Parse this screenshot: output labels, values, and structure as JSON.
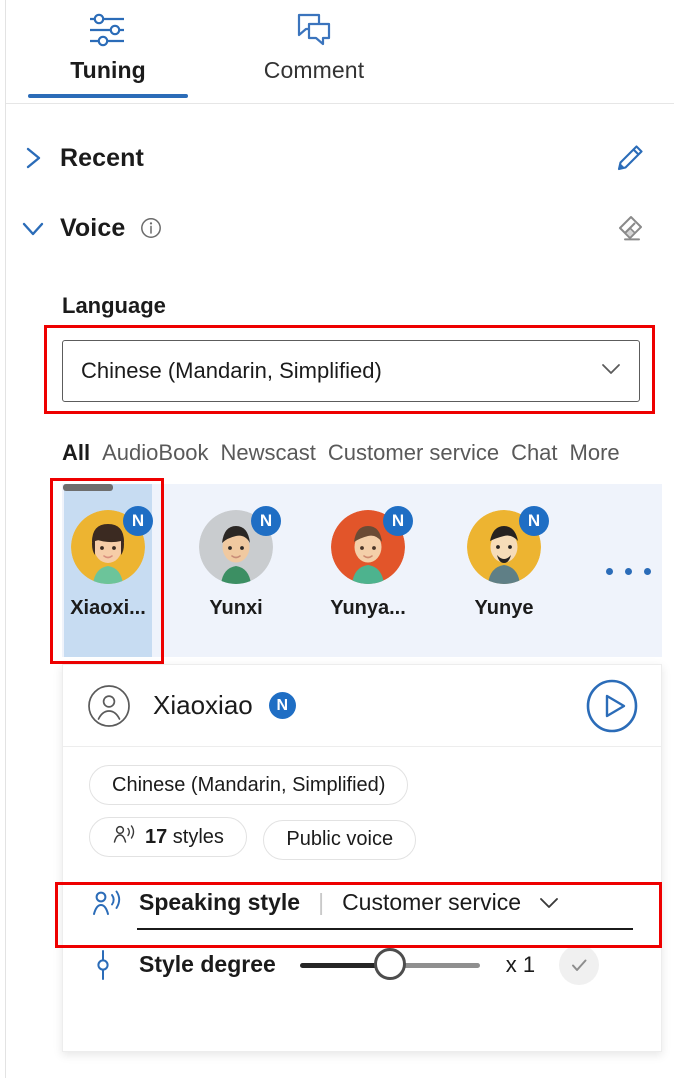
{
  "tabs": [
    {
      "label": "Tuning",
      "icon": "tuning-sliders-icon",
      "active": true
    },
    {
      "label": "Comment",
      "icon": "comment-bubbles-icon",
      "active": false
    }
  ],
  "sections": {
    "recent": {
      "title": "Recent",
      "expanded": false,
      "action_icon": "pencil-edit-icon"
    },
    "voice": {
      "title": "Voice",
      "expanded": true,
      "info_icon": "info-circle-icon",
      "action_icon": "eraser-icon"
    }
  },
  "language": {
    "label": "Language",
    "value": "Chinese (Mandarin, Simplified)",
    "chevron_icon": "chevron-down-icon",
    "highlight_color": "#ee0000"
  },
  "categories": [
    {
      "label": "All",
      "active": true
    },
    {
      "label": "AudioBook",
      "active": false
    },
    {
      "label": "Newscast",
      "active": false
    },
    {
      "label": "Customer service",
      "active": false
    },
    {
      "label": "Chat",
      "active": false
    },
    {
      "label": "More",
      "active": false
    }
  ],
  "voices": [
    {
      "name": "Xiaoxi...",
      "badge": "N",
      "selected": true,
      "avatar_bg": "#edb431",
      "hair": "#3b2a21",
      "skin": "#f6cda8",
      "shirt": "#6cc49a"
    },
    {
      "name": "Yunxi",
      "badge": "N",
      "selected": false,
      "avatar_bg": "#c9cccf",
      "hair": "#2b2724",
      "skin": "#f0c9a0",
      "shirt": "#3c8f63"
    },
    {
      "name": "Yunya...",
      "badge": "N",
      "selected": false,
      "avatar_bg": "#e2552a",
      "hair": "#6b4b35",
      "skin": "#f4cfa9",
      "shirt": "#4db38e"
    },
    {
      "name": "Yunye",
      "badge": "N",
      "selected": false,
      "avatar_bg": "#edb431",
      "hair": "#262220",
      "skin": "#f6dcb8",
      "shirt": "#5f7f86"
    }
  ],
  "voice_more_icon": "more-horizontal-icon",
  "detail": {
    "person_icon": "person-circle-icon",
    "name": "Xiaoxiao",
    "badge": "N",
    "play_icon": "play-circle-icon",
    "tags": [
      {
        "label": "Chinese (Mandarin, Simplified)",
        "icon": null
      },
      {
        "label": "17 styles",
        "bold_prefix": "17",
        "rest": " styles",
        "icon": "person-speaking-icon"
      },
      {
        "label": "Public voice",
        "icon": null
      }
    ],
    "speaking_style": {
      "icon": "person-speaking-icon",
      "label": "Speaking style",
      "separator": "|",
      "value": "Customer service",
      "chevron_icon": "chevron-down-icon"
    },
    "style_degree": {
      "icon": "style-degree-icon",
      "label": "Style degree",
      "value": "x 1",
      "slider_percent": 50,
      "confirm_icon": "check-icon"
    }
  },
  "colors": {
    "accent": "#2b6cb8",
    "badge_blue": "#1f6ec4",
    "highlight_red": "#ee0000",
    "strip_bg": "#eff3fb",
    "selected_card_bg": "#c7dcf2"
  }
}
